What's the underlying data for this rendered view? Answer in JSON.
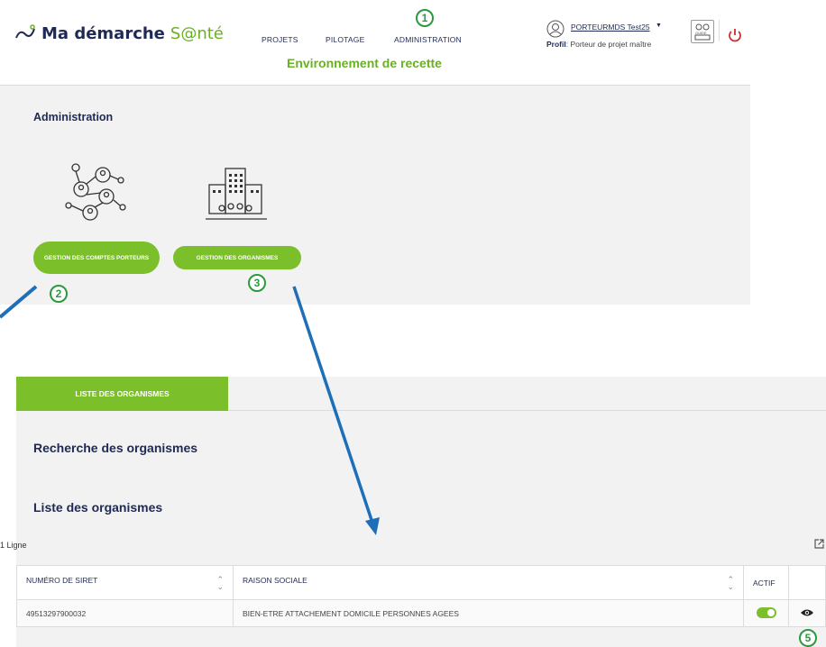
{
  "header": {
    "logo_main": "Ma démarche",
    "logo_accent": "S@nté",
    "nav": [
      "PROJETS",
      "PILOTAGE",
      "ADMINISTRATION"
    ],
    "environment": "Environnement de recette",
    "user_name": "PORTEURMDS Test25",
    "profile_label": "Profil",
    "profile_value": ": Porteur de projet maître",
    "guide_label": "GUIDE"
  },
  "admin": {
    "title": "Administration",
    "cards": [
      {
        "label": "GESTION DES COMPTES PORTEURS"
      },
      {
        "label": "GESTION DES ORGANISMES"
      }
    ]
  },
  "annotations": [
    "1",
    "2",
    "3",
    "5"
  ],
  "organismes": {
    "tab_label": "LISTE DES ORGANISMES",
    "search_title": "Recherche des organismes",
    "list_title": "Liste des organismes",
    "count": "1 Ligne",
    "columns": [
      "NUMÉRO DE SIRET",
      "RAISON SOCIALE",
      "ACTIF",
      ""
    ],
    "rows": [
      {
        "siret": "49513297900032",
        "raison": "BIEN-ETRE ATTACHEMENT DOMICILE PERSONNES AGEES",
        "actif": true
      }
    ]
  },
  "colors": {
    "accent": "#7bbf2a",
    "brand": "#1e2a55",
    "annotation": "#2b9a3e",
    "arrow": "#1f6fb8"
  }
}
